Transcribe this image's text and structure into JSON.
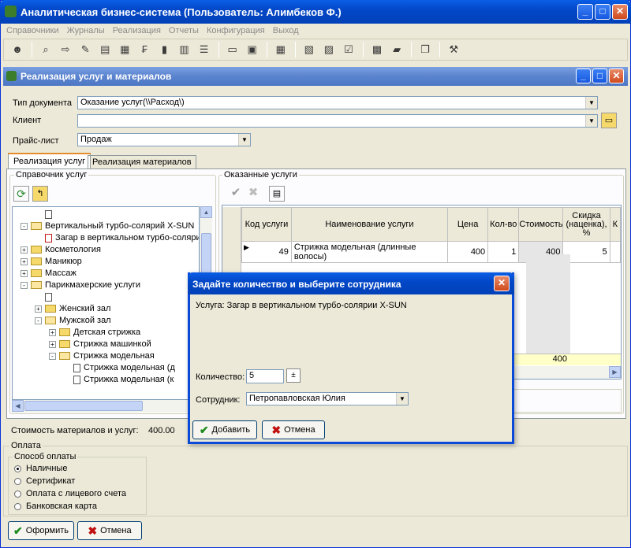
{
  "app": {
    "title": "Аналитическая бизнес-система  (Пользователь: Алимбеков Ф.)"
  },
  "menu": [
    "Справочники",
    "Журналы",
    "Реализация",
    "Отчеты",
    "Конфигурация",
    "Выход"
  ],
  "child": {
    "title": "Реализация услуг и материалов"
  },
  "form": {
    "doc_type_label": "Тип документа",
    "doc_type_value": "Оказание услуг(\\\\Расход\\)",
    "client_label": "Клиент",
    "client_value": "",
    "price_label": "Прайс-лист",
    "price_value": "Продаж"
  },
  "tabs": [
    "Реализация услуг",
    "Реализация материалов"
  ],
  "services_panel": {
    "title": "Справочник услуг"
  },
  "tree": [
    {
      "indent": 2,
      "kind": "doc",
      "exp": "",
      "label": ""
    },
    {
      "indent": 1,
      "kind": "folder-open",
      "exp": "-",
      "label": "Вертикальный турбо-солярий X-SUN"
    },
    {
      "indent": 2,
      "kind": "doc-red",
      "exp": "",
      "label": "Загар в вертикальном турбо-солярии"
    },
    {
      "indent": 1,
      "kind": "folder",
      "exp": "+",
      "label": "Косметология"
    },
    {
      "indent": 1,
      "kind": "folder",
      "exp": "+",
      "label": "Маникюр"
    },
    {
      "indent": 1,
      "kind": "folder",
      "exp": "+",
      "label": "Массаж"
    },
    {
      "indent": 1,
      "kind": "folder-open",
      "exp": "-",
      "label": "Парикмахерские услуги"
    },
    {
      "indent": 2,
      "kind": "doc",
      "exp": "",
      "label": ""
    },
    {
      "indent": 2,
      "kind": "folder",
      "exp": "+",
      "label": "Женский зал"
    },
    {
      "indent": 2,
      "kind": "folder-open",
      "exp": "-",
      "label": "Мужской зал"
    },
    {
      "indent": 3,
      "kind": "folder",
      "exp": "+",
      "label": "Детская стрижка"
    },
    {
      "indent": 3,
      "kind": "folder",
      "exp": "+",
      "label": "Стрижка машинкой"
    },
    {
      "indent": 3,
      "kind": "folder-open",
      "exp": "-",
      "label": "Стрижка модельная"
    },
    {
      "indent": 4,
      "kind": "doc",
      "exp": "",
      "label": "Стрижка модельная (д"
    },
    {
      "indent": 4,
      "kind": "doc",
      "exp": "",
      "label": "Стрижка модельная (к"
    }
  ],
  "rendered": {
    "title": "Оказанные услуги"
  },
  "grid": {
    "headers": [
      "Код услуги",
      "Наименование услуги",
      "Цена",
      "Кол-во",
      "Стоимость",
      "Скидка (наценка), %",
      "К"
    ],
    "row": [
      "49",
      "Стрижка модельная (длинные волосы)",
      "400",
      "1",
      "400",
      "5"
    ],
    "total": "400"
  },
  "summary": {
    "label": "Стоимость материалов и услуг:",
    "value": "400.00"
  },
  "payment": {
    "group": "Оплата",
    "sub": "Способ оплаты",
    "options": [
      "Наличные",
      "Сертификат",
      "Оплата с лицевого счета",
      "Банковская карта"
    ],
    "selected": 0
  },
  "buttons": {
    "submit": "Оформить",
    "cancel": "Отмена"
  },
  "dialog": {
    "title": "Задайте количество и выберите сотрудника",
    "service": "Услуга: Загар в вертикальном турбо-солярии X-SUN",
    "qty_label": "Количество:",
    "qty_value": "5",
    "employee_label": "Сотрудник:",
    "employee_value": "Петропавловская Юлия",
    "add": "Добавить",
    "cancel": "Отмена"
  }
}
